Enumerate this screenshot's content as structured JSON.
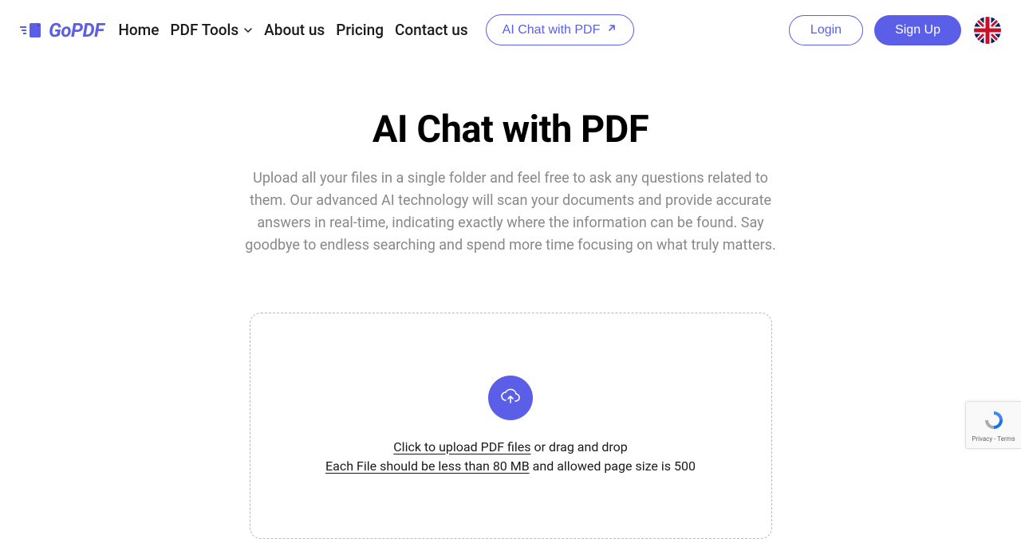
{
  "brand": {
    "name": "GoPDF"
  },
  "nav": {
    "home": "Home",
    "pdf_tools": "PDF Tools",
    "about": "About us",
    "pricing": "Pricing",
    "contact": "Contact us",
    "ai_chat": "AI Chat with PDF"
  },
  "auth": {
    "login": "Login",
    "signup": "Sign Up"
  },
  "hero": {
    "title": "AI Chat with PDF",
    "description": "Upload all your files in a single folder and feel free to ask any questions related to them. Our advanced AI technology will scan your documents and provide accurate answers in real-time, indicating exactly where the information can be found. Say goodbye to endless searching and spend more time focusing on what truly matters."
  },
  "upload": {
    "click_text": "Click to upload PDF files",
    "drag_text": " or drag and drop",
    "limit_text": "Each File should be less than 80 MB",
    "page_text": " and allowed page size is 500"
  },
  "recaptcha": {
    "privacy": "Privacy",
    "dash": " - ",
    "terms": "Terms"
  }
}
